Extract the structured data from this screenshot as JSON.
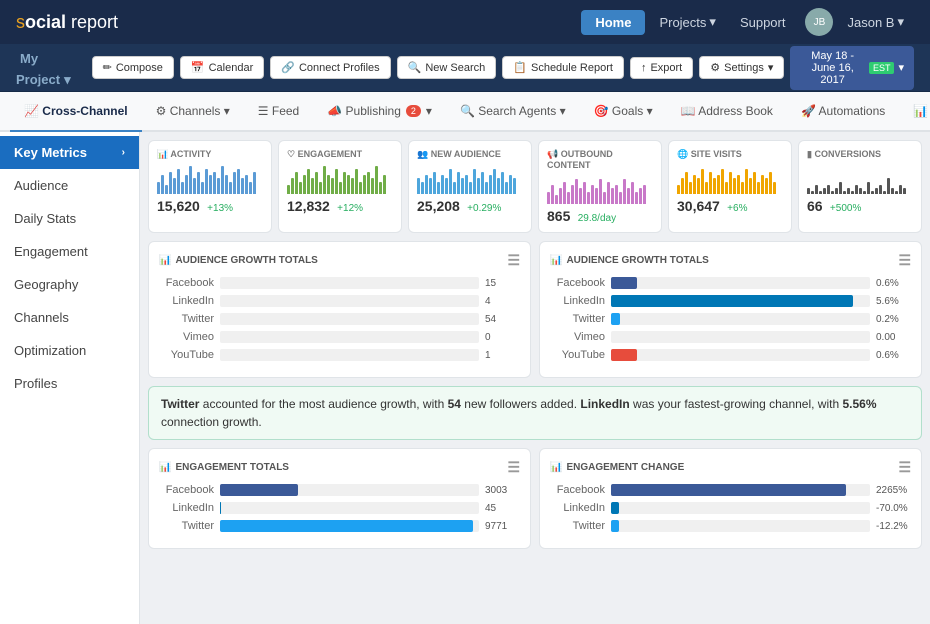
{
  "topnav": {
    "logo_s": "s",
    "logo_rest": "ocial report",
    "home_label": "Home",
    "projects_label": "Projects",
    "support_label": "Support",
    "user_label": "Jason B",
    "avatar_text": "JB"
  },
  "projectbar": {
    "title": "My Project",
    "compose_label": "Compose",
    "calendar_label": "Calendar",
    "connect_label": "Connect Profiles",
    "search_label": "New Search",
    "schedule_label": "Schedule Report",
    "export_label": "Export",
    "settings_label": "Settings",
    "date_range": "May 18 - June 16, 2017",
    "timezone": "EST"
  },
  "channelbar": {
    "tabs": [
      {
        "id": "cross-channel",
        "label": "Cross-Channel",
        "active": true
      },
      {
        "id": "channels",
        "label": "Channels"
      },
      {
        "id": "feed",
        "label": "Feed"
      },
      {
        "id": "publishing",
        "label": "Publishing",
        "badge": "2"
      },
      {
        "id": "search",
        "label": "Search Agents"
      },
      {
        "id": "goals",
        "label": "Goals"
      },
      {
        "id": "address-book",
        "label": "Address Book"
      },
      {
        "id": "automations",
        "label": "Automations"
      },
      {
        "id": "reports",
        "label": "Reports"
      }
    ]
  },
  "sidebar": {
    "items": [
      {
        "id": "key-metrics",
        "label": "Key Metrics",
        "active": true
      },
      {
        "id": "audience",
        "label": "Audience"
      },
      {
        "id": "daily-stats",
        "label": "Daily Stats"
      },
      {
        "id": "engagement",
        "label": "Engagement"
      },
      {
        "id": "geography",
        "label": "Geography"
      },
      {
        "id": "channels",
        "label": "Channels"
      },
      {
        "id": "optimization",
        "label": "Optimization"
      },
      {
        "id": "profiles",
        "label": "Profiles"
      }
    ]
  },
  "metrics": [
    {
      "id": "activity",
      "icon": "📊",
      "label": "ACTIVITY",
      "value": "15,620",
      "change": "+13%",
      "change_type": "pos",
      "bar_color": "#5b9bd5",
      "bars": [
        4,
        6,
        3,
        7,
        5,
        8,
        4,
        6,
        9,
        5,
        7,
        4,
        8,
        6,
        7,
        5,
        9,
        6,
        4,
        7,
        8,
        5,
        6,
        4,
        7
      ]
    },
    {
      "id": "engagement",
      "icon": "♡",
      "label": "ENGAGEMENT",
      "value": "12,832",
      "change": "+12%",
      "change_type": "pos",
      "bar_color": "#70ad47",
      "bars": [
        3,
        5,
        7,
        4,
        6,
        8,
        5,
        7,
        4,
        9,
        6,
        5,
        8,
        4,
        7,
        6,
        5,
        8,
        4,
        6,
        7,
        5,
        9,
        4,
        6
      ]
    },
    {
      "id": "new-audience",
      "icon": "👥",
      "label": "NEW AUDIENCE",
      "value": "25,208",
      "change": "+0.29%",
      "change_type": "pos",
      "bar_color": "#4ea6dc",
      "bars": [
        5,
        4,
        6,
        5,
        7,
        4,
        6,
        5,
        8,
        4,
        7,
        5,
        6,
        4,
        8,
        5,
        7,
        4,
        6,
        8,
        5,
        7,
        4,
        6,
        5
      ]
    },
    {
      "id": "outbound",
      "icon": "📢",
      "label": "OUTBOUND CONTENT",
      "value": "865",
      "change": "29.8/day",
      "change_type": "pos",
      "bar_color": "#c878c8",
      "bars": [
        4,
        6,
        3,
        5,
        7,
        4,
        6,
        8,
        5,
        7,
        4,
        6,
        5,
        8,
        4,
        7,
        5,
        6,
        4,
        8,
        5,
        7,
        4,
        5,
        6
      ]
    },
    {
      "id": "site-visits",
      "icon": "🌐",
      "label": "SITE VISITS",
      "value": "30,647",
      "change": "+6%",
      "change_type": "pos",
      "bar_color": "#f0a500",
      "bars": [
        3,
        5,
        7,
        4,
        6,
        5,
        8,
        4,
        7,
        5,
        6,
        8,
        4,
        7,
        5,
        6,
        4,
        8,
        5,
        7,
        4,
        6,
        5,
        7,
        4
      ]
    },
    {
      "id": "conversions",
      "icon": "▮",
      "label": "CONVERSIONS",
      "value": "66",
      "change": "+500%",
      "change_type": "pos",
      "bar_color": "#555",
      "bars": [
        2,
        1,
        3,
        1,
        2,
        3,
        1,
        2,
        4,
        1,
        2,
        1,
        3,
        2,
        1,
        4,
        1,
        2,
        3,
        1,
        5,
        2,
        1,
        3,
        2
      ]
    }
  ],
  "audience_growth": {
    "title": "AUDIENCE GROWTH TOTALS",
    "bars": [
      {
        "label": "Facebook",
        "value": 15,
        "max": 60,
        "color": "#3b5998"
      },
      {
        "label": "LinkedIn",
        "value": 4,
        "max": 60,
        "color": "#0077b5"
      },
      {
        "label": "Twitter",
        "value": 54,
        "max": 60,
        "color": "#1da1f2"
      },
      {
        "label": "Vimeo",
        "value": 0,
        "max": 60,
        "color": "#86c9ef"
      },
      {
        "label": "YouTube",
        "value": 1,
        "max": 60,
        "color": "#e74c3c"
      }
    ]
  },
  "audience_growth_pct": {
    "title": "AUDIENCE GROWTH TOTALS",
    "bars": [
      {
        "label": "Facebook",
        "value": "0.6%",
        "raw": 0.6,
        "max": 6,
        "color": "#3b5998"
      },
      {
        "label": "LinkedIn",
        "value": "5.6%",
        "raw": 5.6,
        "max": 6,
        "color": "#0077b5"
      },
      {
        "label": "Twitter",
        "value": "0.2%",
        "raw": 0.2,
        "max": 6,
        "color": "#1da1f2"
      },
      {
        "label": "Vimeo",
        "value": "0.00",
        "raw": 0,
        "max": 6,
        "color": "#86c9ef"
      },
      {
        "label": "YouTube",
        "value": "0.6%",
        "raw": 0.6,
        "max": 6,
        "color": "#e74c3c"
      }
    ]
  },
  "insight": "Twitter accounted for the most audience growth, with 54 new followers added. LinkedIn was your fastest-growing channel, with 5.56% connection growth.",
  "engagement_totals": {
    "title": "ENGAGEMENT TOTALS",
    "bars": [
      {
        "label": "Facebook",
        "value": "3003",
        "raw": 3003,
        "max": 10000,
        "color": "#3b5998"
      },
      {
        "label": "LinkedIn",
        "value": "45",
        "raw": 45,
        "max": 10000,
        "color": "#0077b5"
      },
      {
        "label": "Twitter",
        "value": "9771",
        "raw": 9771,
        "max": 10000,
        "color": "#1da1f2"
      }
    ]
  },
  "engagement_change": {
    "title": "ENGAGEMENT CHANGE",
    "bars": [
      {
        "label": "Facebook",
        "value": "2265%",
        "raw": 2265,
        "max": 2500,
        "color": "#3b5998"
      },
      {
        "label": "LinkedIn",
        "value": "-70.0%",
        "raw": -70,
        "max": 2500,
        "color": "#0077b5",
        "negative": true
      },
      {
        "label": "Twitter",
        "value": "-12.2%",
        "raw": -12,
        "max": 2500,
        "color": "#1da1f2",
        "negative": true
      }
    ]
  }
}
